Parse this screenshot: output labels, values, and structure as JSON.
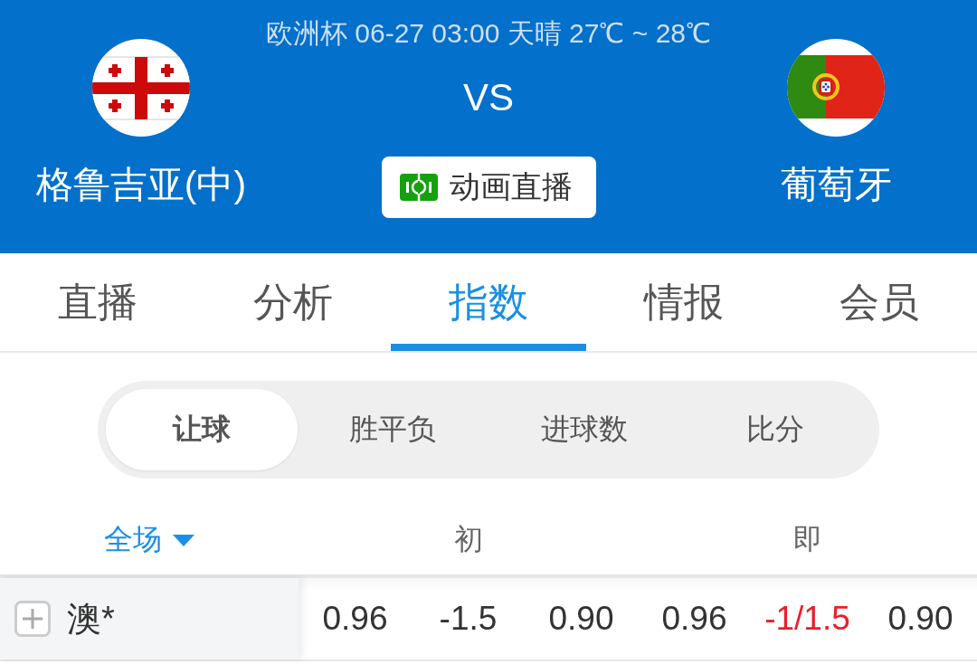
{
  "match_header": {
    "info": "欧洲杯 06-27 03:00 天晴 27℃ ~ 28℃",
    "home_team": {
      "name": "格鲁吉亚(中)"
    },
    "vs": "VS",
    "away_team": {
      "name": "葡萄牙"
    },
    "live_button": {
      "label": "动画直播"
    }
  },
  "tabs": [
    {
      "label": "直播",
      "selected": false
    },
    {
      "label": "分析",
      "selected": false
    },
    {
      "label": "指数",
      "selected": true
    },
    {
      "label": "情报",
      "selected": false
    },
    {
      "label": "会员",
      "selected": false
    }
  ],
  "odds_types": [
    {
      "label": "让球",
      "selected": true
    },
    {
      "label": "胜平负",
      "selected": false
    },
    {
      "label": "进球数",
      "selected": false
    },
    {
      "label": "比分",
      "selected": false
    }
  ],
  "odds_table": {
    "period_selector": {
      "label": "全场"
    },
    "columns": [
      {
        "label": "初"
      },
      {
        "label": "即"
      }
    ],
    "rows": [
      {
        "company": "澳*",
        "expanded": false,
        "values": [
          {
            "text": "0.96",
            "color": "#333333"
          },
          {
            "text": "-1.5",
            "color": "#333333"
          },
          {
            "text": "0.90",
            "color": "#333333"
          },
          {
            "text": "0.96",
            "color": "#333333"
          },
          {
            "text": "-1/1.5",
            "color": "#e8202a"
          },
          {
            "text": "0.90",
            "color": "#333333"
          }
        ]
      }
    ]
  }
}
